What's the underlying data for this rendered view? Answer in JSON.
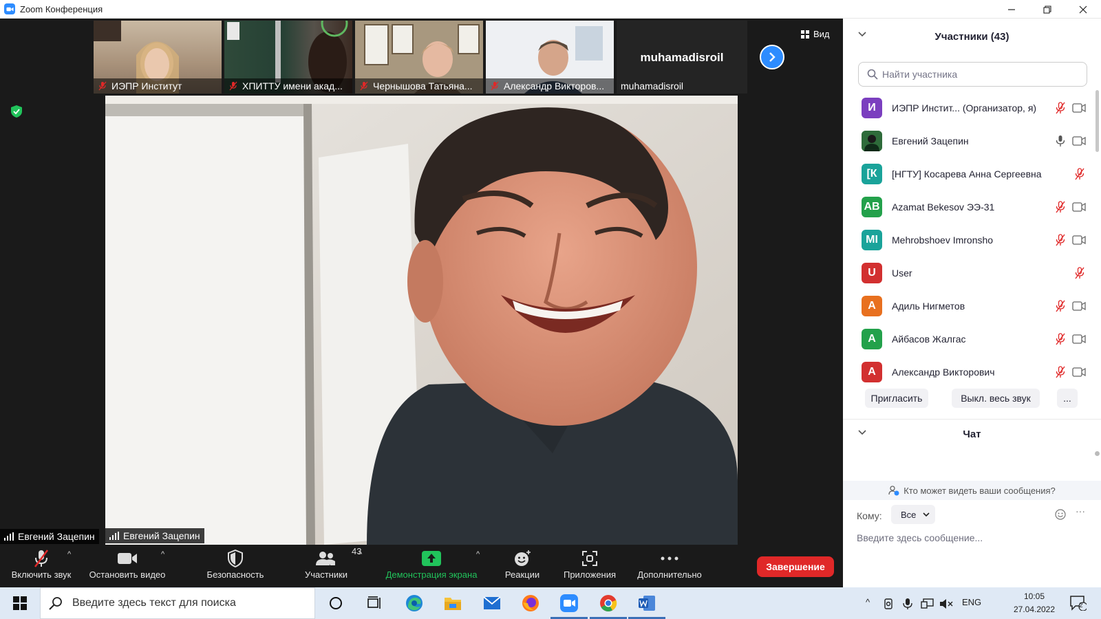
{
  "window": {
    "title": "Zoom Конференция"
  },
  "view": {
    "label": "Вид"
  },
  "thumbnails": [
    {
      "name": "ИЭПР Институт"
    },
    {
      "name": "ХПИТТУ имени акад..."
    },
    {
      "name": "Чернышова Татьяна..."
    },
    {
      "name": "Александр Викторов..."
    }
  ],
  "name_card": {
    "big_name": "muhamadisroil",
    "label": "muhamadisroil"
  },
  "active_speaker": {
    "name": "Евгений Зацепин"
  },
  "toolbar": {
    "unmute": "Включить звук",
    "stop_video": "Остановить видео",
    "security": "Безопасность",
    "participants": "Участники",
    "participants_count": "43",
    "share_screen": "Демонстрация экрана",
    "reactions": "Реакции",
    "apps": "Приложения",
    "more": "Дополнительно",
    "end": "Завершение"
  },
  "participants_panel": {
    "title": "Участники (43)",
    "search_placeholder": "Найти участника",
    "items": [
      {
        "initials": "И",
        "name": "ИЭПР Инстит... (Организатор, я)",
        "color": "#7b3fbf",
        "mic": "muted",
        "cam": true
      },
      {
        "initials": "",
        "name": "Евгений Зацепин",
        "color": "#2e6b3a",
        "mic": "on",
        "cam": true
      },
      {
        "initials": "[К",
        "name": "[НГТУ] Косарева Анна Сергеевна",
        "color": "#1aa39a",
        "mic": "muted",
        "cam": false
      },
      {
        "initials": "AB",
        "name": "Azamat Bekesov ЭЭ-31",
        "color": "#23a14b",
        "mic": "muted",
        "cam": true
      },
      {
        "initials": "MI",
        "name": "Mehrobshoev Imronsho",
        "color": "#1aa39a",
        "mic": "muted",
        "cam": true
      },
      {
        "initials": "U",
        "name": "User",
        "color": "#d23030",
        "mic": "muted",
        "cam": false
      },
      {
        "initials": "А",
        "name": "Адиль Нигметов",
        "color": "#e8701f",
        "mic": "muted",
        "cam": true
      },
      {
        "initials": "А",
        "name": "Айбасов Жалгас",
        "color": "#23a14b",
        "mic": "muted",
        "cam": true
      },
      {
        "initials": "А",
        "name": "Александр Викторович",
        "color": "#d23030",
        "mic": "muted",
        "cam": true
      }
    ],
    "invite": "Пригласить",
    "mute_all": "Выкл. весь звук",
    "more": "..."
  },
  "chat": {
    "title": "Чат",
    "who_can_see": "Кто может видеть ваши сообщения?",
    "to_label": "Кому:",
    "to_value": "Все",
    "placeholder": "Введите здесь сообщение..."
  },
  "taskbar": {
    "search_placeholder": "Введите здесь текст для поиска",
    "lang": "ENG",
    "time": "10:05",
    "date": "27.04.2022",
    "notifications": "2"
  },
  "colors": {
    "zoom_blue": "#2d8cff",
    "end_red": "#e02828",
    "share_green": "#21c35b"
  }
}
